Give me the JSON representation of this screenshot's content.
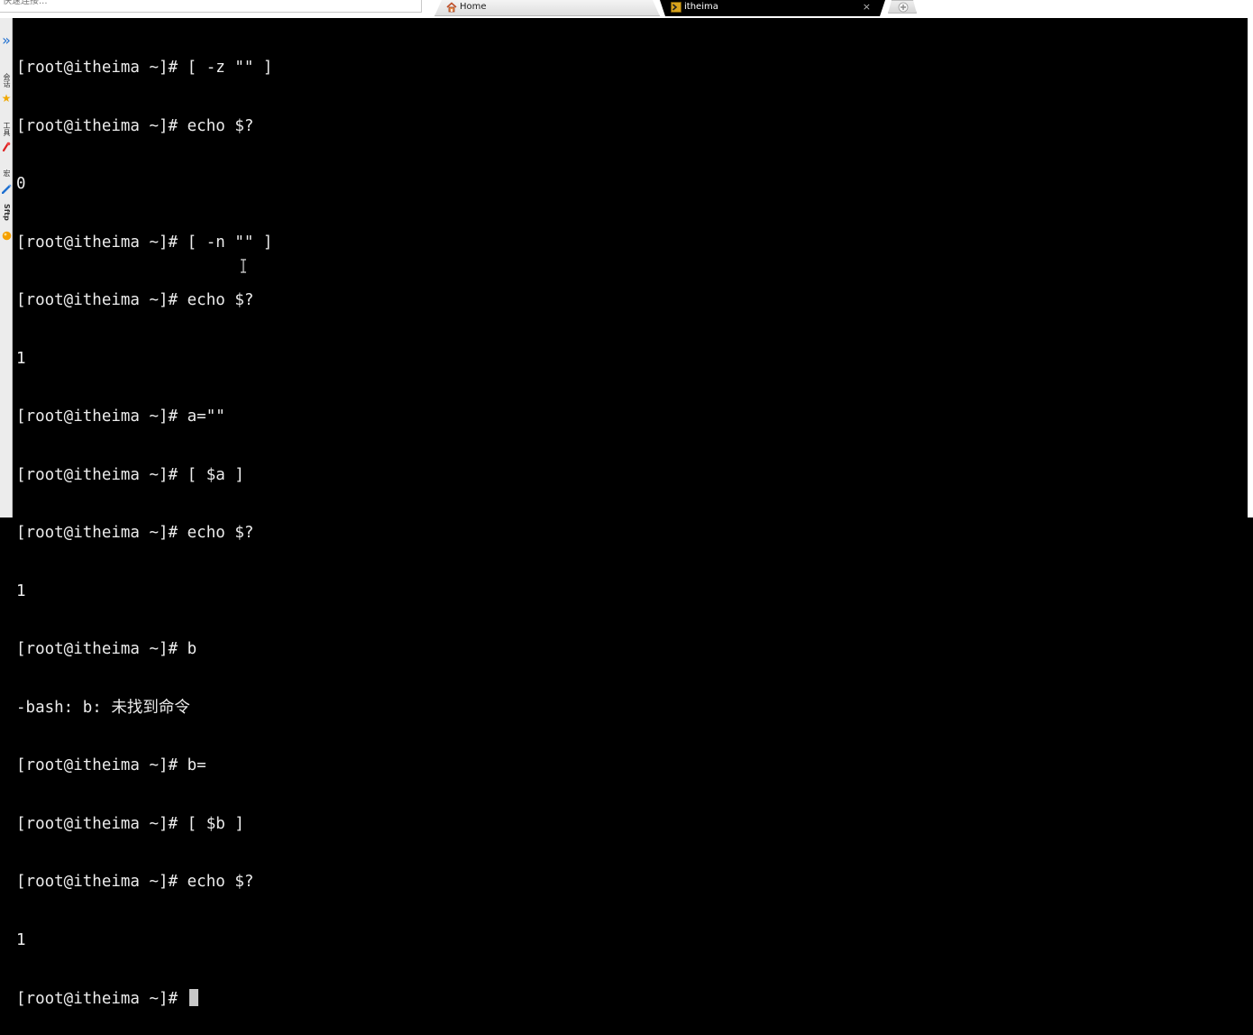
{
  "toolbar": {
    "quick_connect_label": "快速连接..."
  },
  "tabs": [
    {
      "label": "Home",
      "icon": "home-icon"
    },
    {
      "label": "itheima",
      "icon": "terminal-icon",
      "close": "×",
      "active": true
    }
  ],
  "new_tab_icon": "plus-icon",
  "sidebar": {
    "items": [
      {
        "type": "icon",
        "name": "double-chevron-right-icon",
        "glyph": "»"
      },
      {
        "type": "text",
        "text": "会话"
      },
      {
        "type": "icon",
        "name": "star-icon",
        "glyph": "★"
      },
      {
        "type": "text",
        "text": "工具"
      },
      {
        "type": "icon",
        "name": "pin-icon"
      },
      {
        "type": "text",
        "text": "宏"
      },
      {
        "type": "icon",
        "name": "pen-icon"
      },
      {
        "type": "text",
        "text": "Sftp"
      },
      {
        "type": "icon",
        "name": "orange-circle-icon"
      }
    ]
  },
  "terminal": {
    "lines": [
      "[root@itheima ~]# [ -z \"\" ]",
      "[root@itheima ~]# echo $?",
      "0",
      "[root@itheima ~]# [ -n \"\" ]",
      "[root@itheima ~]# echo $?",
      "1",
      "[root@itheima ~]# a=\"\"",
      "[root@itheima ~]# [ $a ]",
      "[root@itheima ~]# echo $?",
      "1",
      "[root@itheima ~]# b",
      "-bash: b: 未找到命令",
      "[root@itheima ~]# b=",
      "[root@itheima ~]# [ $b ]",
      "[root@itheima ~]# echo $?",
      "1",
      "[root@itheima ~]# "
    ]
  },
  "colors": {
    "terminal_bg": "#000000",
    "terminal_fg": "#ececec",
    "cursor": "#c8c8c8",
    "accent_blue": "#1e6fd0",
    "home_icon": "#c0502a"
  }
}
